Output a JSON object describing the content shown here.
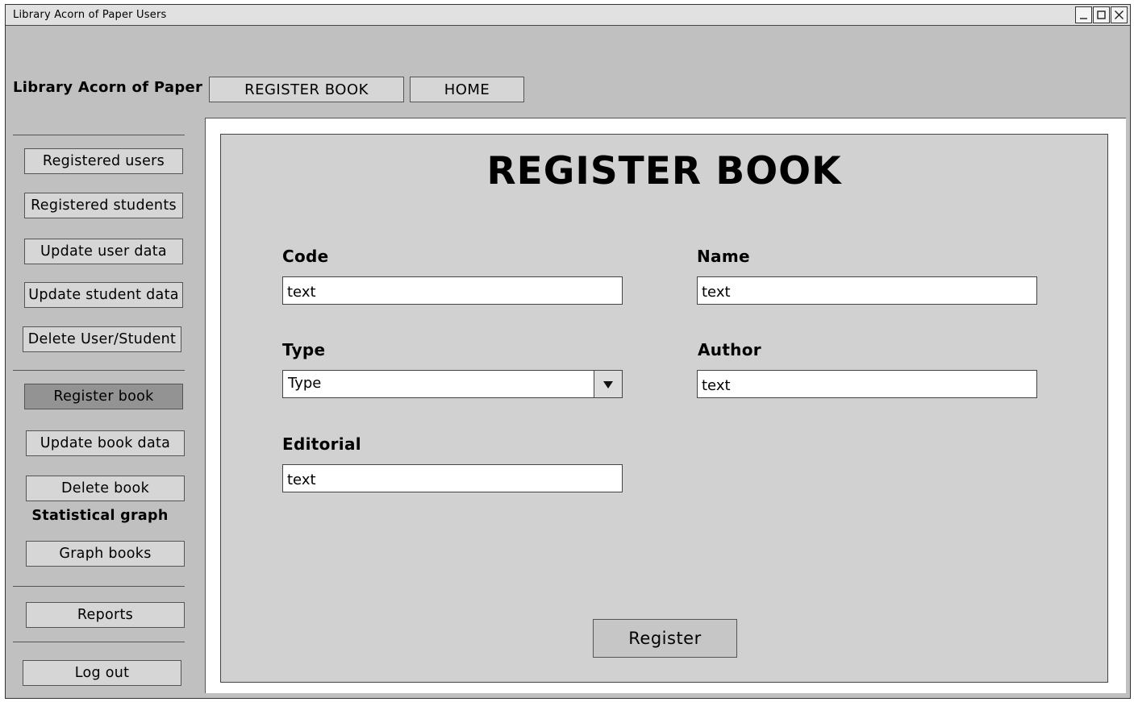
{
  "window": {
    "title": "Library Acorn of Paper Users",
    "controls": [
      "minimize-icon",
      "maximize-icon",
      "close-icon"
    ]
  },
  "header": {
    "app_title": "Library Acorn of Paper",
    "nav": {
      "register_book": "REGISTER BOOK",
      "home": "HOME"
    }
  },
  "sidebar": {
    "items": [
      {
        "label": "Registered users"
      },
      {
        "label": "Registered students"
      },
      {
        "label": "Update user data"
      },
      {
        "label": "Update student data"
      },
      {
        "label": "Delete User/Student"
      },
      {
        "label": "Register book",
        "active": true
      },
      {
        "label": "Update book data"
      },
      {
        "label": "Delete book"
      },
      {
        "label": "Graph books"
      },
      {
        "label": "Reports"
      },
      {
        "label": "Log out"
      }
    ],
    "statistical_heading": "Statistical graph"
  },
  "form": {
    "heading": "REGISTER BOOK",
    "code": {
      "label": "Code",
      "placeholder": "text"
    },
    "name": {
      "label": "Name",
      "placeholder": "text"
    },
    "type": {
      "label": "Type",
      "selected": "Type"
    },
    "author": {
      "label": "Author",
      "placeholder": "text"
    },
    "editorial": {
      "label": "Editorial",
      "placeholder": "text"
    },
    "submit_label": "Register"
  },
  "colors": {
    "window_bg": "#c0c0c0",
    "panel_bg": "#d1d1d1",
    "button_bg": "#d6d6d6",
    "active_button_bg": "#939393"
  }
}
